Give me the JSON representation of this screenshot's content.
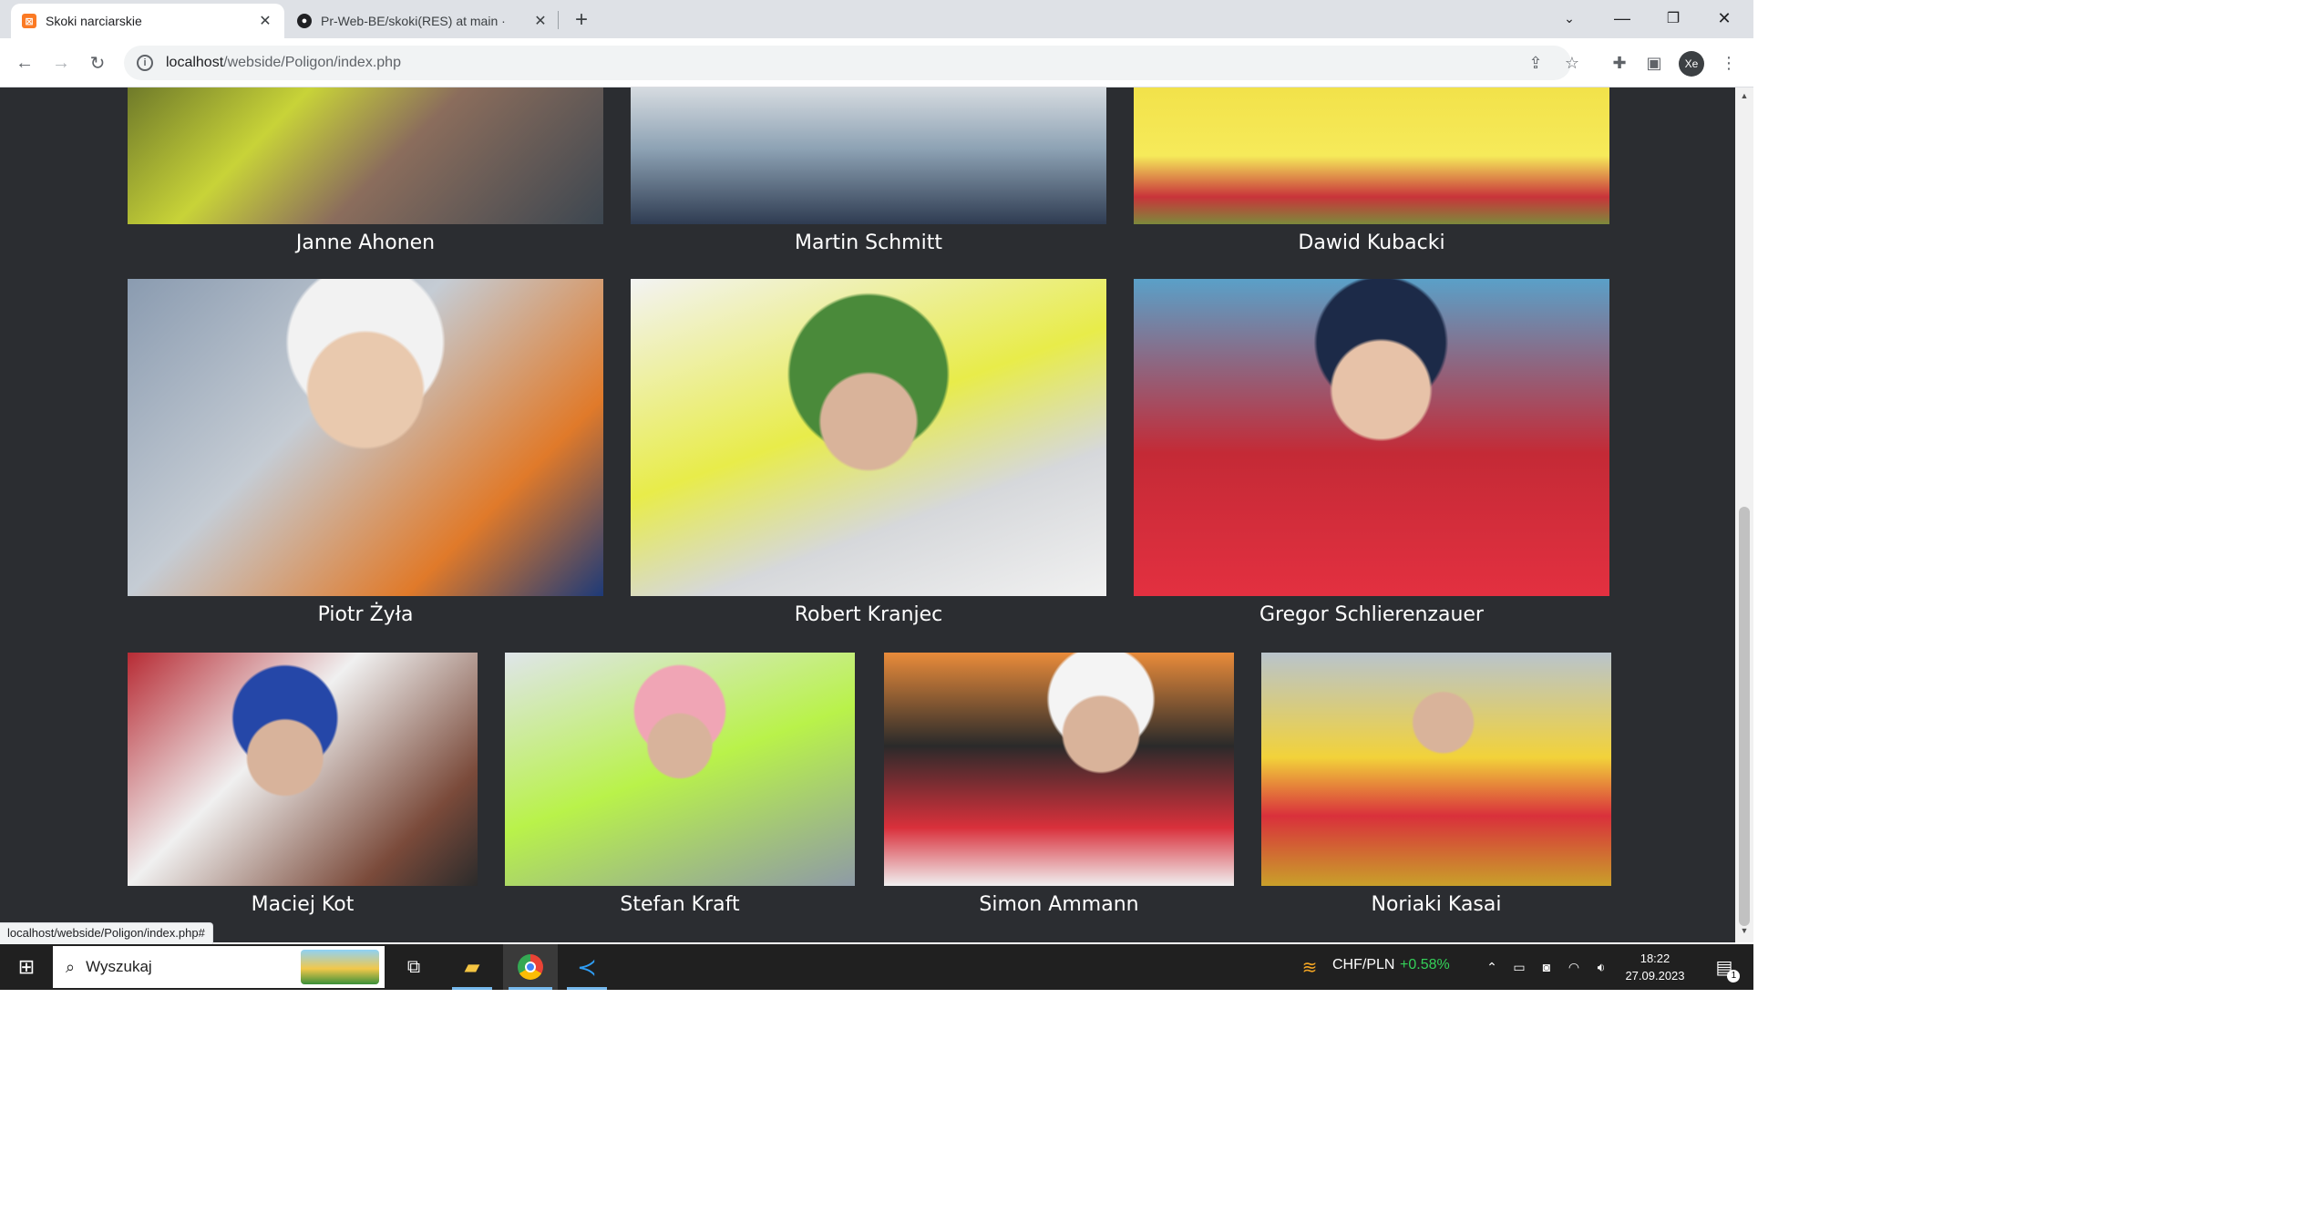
{
  "browser": {
    "tabs": [
      {
        "title": "Skoki narciarskie",
        "favicon": "xampp-icon",
        "active": true
      },
      {
        "title": "Pr-Web-BE/skoki(RES) at main ·",
        "favicon": "github-icon",
        "active": false
      }
    ],
    "url_host": "localhost",
    "url_path": "/webside/Poligon/index.php",
    "profile_initials": "Xe",
    "status_url": "localhost/webside/Poligon/index.php#"
  },
  "jumpers": {
    "row1": [
      {
        "name": "Janne Ahonen"
      },
      {
        "name": "Martin Schmitt"
      },
      {
        "name": "Dawid Kubacki"
      }
    ],
    "row2": [
      {
        "name": "Piotr Żyła"
      },
      {
        "name": "Robert Kranjec"
      },
      {
        "name": "Gregor Schlierenzauer"
      }
    ],
    "row3": [
      {
        "name": "Maciej Kot"
      },
      {
        "name": "Stefan Kraft"
      },
      {
        "name": "Simon Ammann"
      },
      {
        "name": "Noriaki Kasai"
      }
    ]
  },
  "taskbar": {
    "search_placeholder": "Wyszukaj",
    "ticker_label": "CHF/PLN",
    "ticker_change": "+0.58%",
    "time": "18:22",
    "date": "27.09.2023",
    "notification_count": "1"
  },
  "colors": {
    "page_bg": "#2b2d31",
    "ticker_positive": "#34d058"
  }
}
